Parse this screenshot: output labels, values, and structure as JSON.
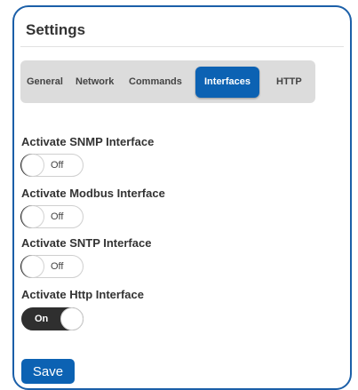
{
  "panel": {
    "title": "Settings"
  },
  "tabs": [
    {
      "label": "General",
      "active": false
    },
    {
      "label": "Network",
      "active": false
    },
    {
      "label": "Commands",
      "active": false
    },
    {
      "label": "Interfaces",
      "active": true
    },
    {
      "label": "HTTP",
      "active": false
    }
  ],
  "settings": [
    {
      "label": "Activate SNMP Interface",
      "state": "Off"
    },
    {
      "label": "Activate Modbus Interface",
      "state": "Off"
    },
    {
      "label": "Activate SNTP Interface",
      "state": "Off"
    },
    {
      "label": "Activate Http Interface",
      "state": "On"
    }
  ],
  "actions": {
    "save_label": "Save"
  },
  "colors": {
    "accent": "#0c62b3",
    "border": "#1b5fa8",
    "toggle_on": "#2f2f2f",
    "tabbar": "#dcdcdc"
  }
}
